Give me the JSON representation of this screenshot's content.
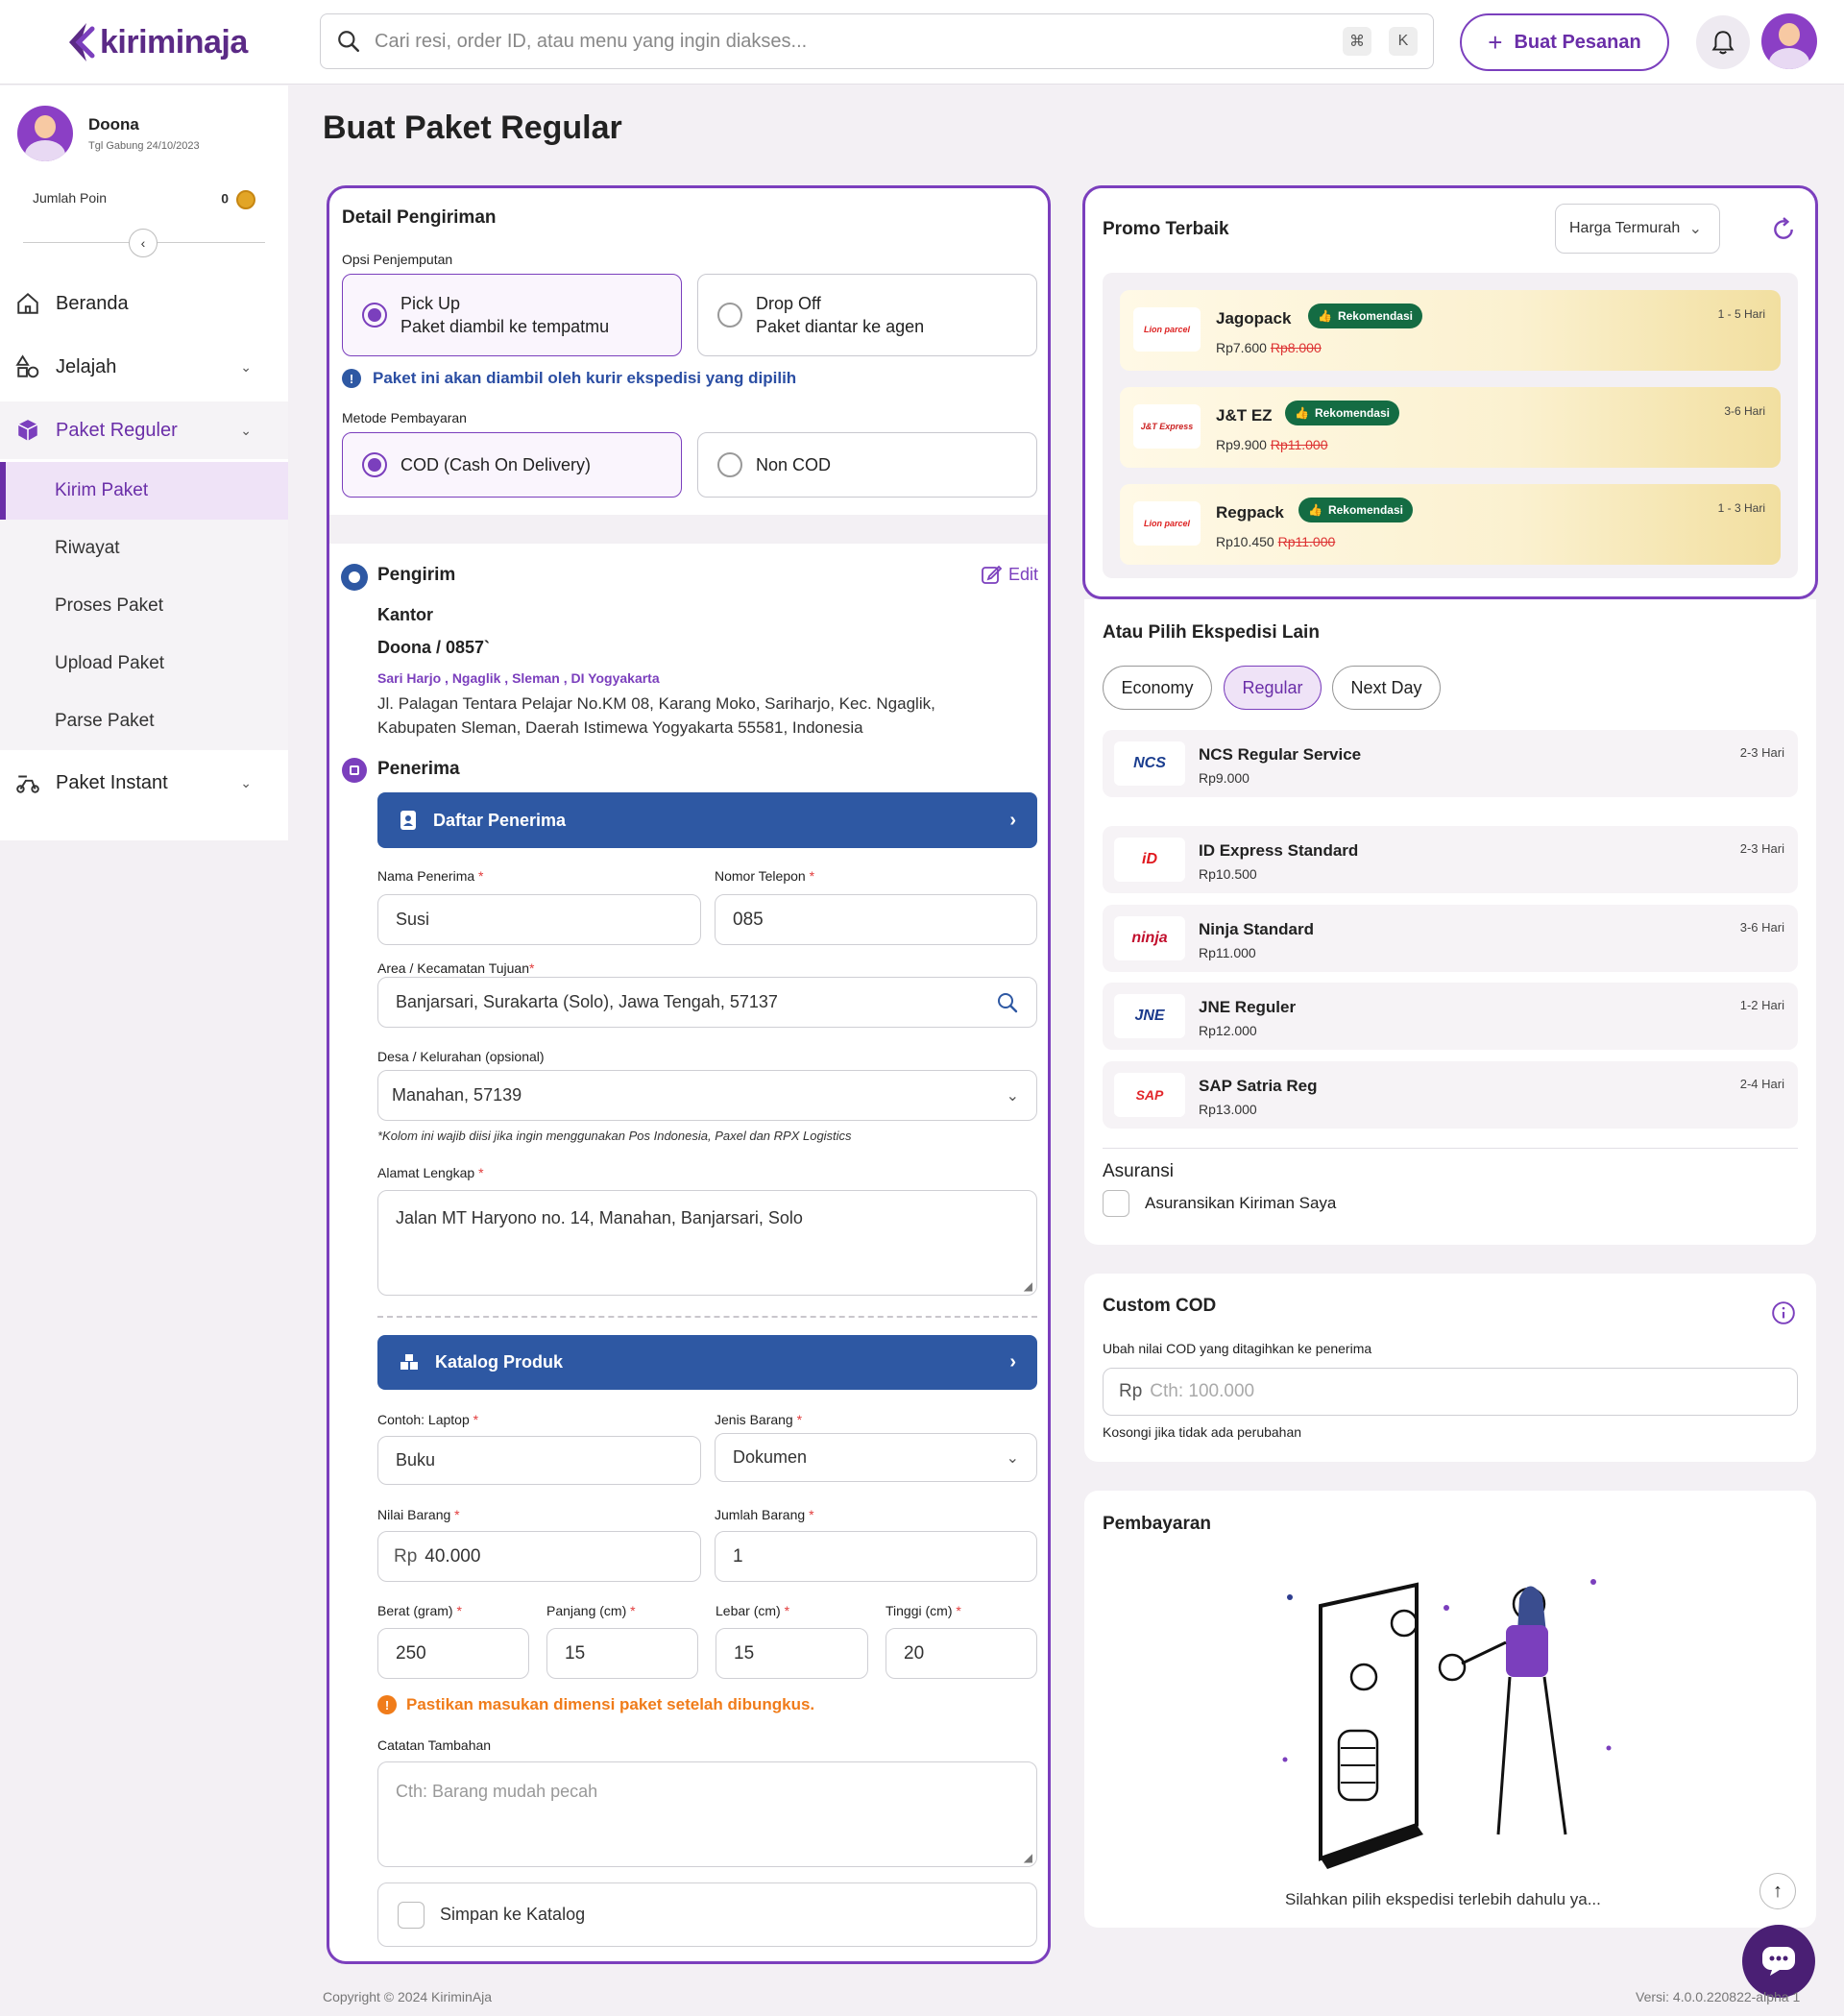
{
  "brand": {
    "name": "kiriminaja",
    "accent": "#7b3fbd",
    "blue": "#2e58a3"
  },
  "topbar": {
    "search_placeholder": "Cari resi, order ID, atau menu yang ingin diakses...",
    "kbd_cmd": "⌘",
    "kbd_k": "K",
    "create_order": "Buat Pesanan"
  },
  "sidebar": {
    "user_name": "Doona",
    "join_date": "Tgl Gabung 24/10/2023",
    "points_label": "Jumlah Poin",
    "points_value": "0",
    "items": [
      {
        "label": "Beranda"
      },
      {
        "label": "Jelajah"
      },
      {
        "label": "Paket Reguler"
      },
      {
        "label": "Paket Instant"
      }
    ],
    "sub_items": [
      {
        "label": "Kirim Paket"
      },
      {
        "label": "Riwayat"
      },
      {
        "label": "Proses Paket"
      },
      {
        "label": "Upload Paket"
      },
      {
        "label": "Parse Paket"
      }
    ]
  },
  "page_title": "Buat Paket Regular",
  "detail": {
    "title": "Detail Pengiriman",
    "pickup_label": "Opsi Penjemputan",
    "pickup_options": [
      {
        "title": "Pick Up",
        "desc": "Paket diambil ke tempatmu"
      },
      {
        "title": "Drop Off",
        "desc": "Paket diantar ke agen"
      }
    ],
    "pickup_info": "Paket ini akan diambil oleh kurir ekspedisi yang dipilih",
    "payment_label": "Metode Pembayaran",
    "payment_options": [
      {
        "title": "COD (Cash On Delivery)"
      },
      {
        "title": "Non COD"
      }
    ]
  },
  "sender": {
    "title": "Pengirim",
    "edit": "Edit",
    "place": "Kantor",
    "name_phone": "Doona / 0857`",
    "area": [
      "Sari Harjo",
      "Ngaglik",
      "Sleman",
      "DI Yogyakarta"
    ],
    "address": "Jl. Palagan Tentara Pelajar No.KM 08, Karang Moko, Sariharjo, Kec. Ngaglik, Kabupaten Sleman, Daerah Istimewa Yogyakarta 55581, Indonesia"
  },
  "receiver": {
    "title": "Penerima",
    "list_button": "Daftar Penerima",
    "name_label": "Nama Penerima",
    "name_value": "Susi",
    "phone_label": "Nomor Telepon",
    "phone_value": "085",
    "area_label": "Area / Kecamatan Tujuan",
    "area_value": "Banjarsari, Surakarta (Solo), Jawa Tengah, 57137",
    "village_label": "Desa / Kelurahan (opsional)",
    "village_value": "Manahan, 57139",
    "village_note": "*Kolom ini wajib diisi jika ingin menggunakan Pos Indonesia, Paxel dan RPX Logistics",
    "address_label": "Alamat Lengkap",
    "address_value": "Jalan MT Haryono no. 14, Manahan, Banjarsari, Solo"
  },
  "product": {
    "catalog_button": "Katalog Produk",
    "name_label": "Contoh: Laptop",
    "name_value": "Buku",
    "type_label": "Jenis Barang",
    "type_value": "Dokumen",
    "value_label": "Nilai Barang",
    "currency": "Rp",
    "value_value": "40.000",
    "qty_label": "Jumlah Barang",
    "qty_value": "1",
    "weight_label": "Berat (gram)",
    "weight_value": "250",
    "length_label": "Panjang (cm)",
    "length_value": "15",
    "width_label": "Lebar (cm)",
    "width_value": "15",
    "height_label": "Tinggi (cm)",
    "height_value": "20",
    "dimension_warning": "Pastikan masukan dimensi paket setelah dibungkus.",
    "note_label": "Catatan Tambahan",
    "note_placeholder": "Cth: Barang mudah pecah",
    "save_catalog": "Simpan ke Katalog"
  },
  "promo": {
    "title": "Promo Terbaik",
    "sort_value": "Harga Termurah",
    "badge": "Rekomendasi",
    "items": [
      {
        "logo": "Lion parcel",
        "name": "Jagopack",
        "price": "Rp7.600",
        "old_price": "Rp8.000",
        "days": "1 - 5 Hari"
      },
      {
        "logo": "J&T Express",
        "name": "J&T EZ",
        "price": "Rp9.900",
        "old_price": "Rp11.000",
        "days": "3-6 Hari"
      },
      {
        "logo": "Lion parcel",
        "name": "Regpack",
        "price": "Rp10.450",
        "old_price": "Rp11.000",
        "days": "1 - 3 Hari"
      }
    ]
  },
  "other": {
    "title": "Atau Pilih Ekspedisi Lain",
    "tabs": [
      {
        "label": "Economy"
      },
      {
        "label": "Regular"
      },
      {
        "label": "Next Day"
      }
    ],
    "items": [
      {
        "logo": "NCS",
        "name": "NCS Regular Service",
        "price": "Rp9.000",
        "days": "2-3 Hari"
      },
      {
        "logo": "iD",
        "name": "ID Express Standard",
        "price": "Rp10.500",
        "days": "2-3 Hari"
      },
      {
        "logo": "ninja",
        "name": "Ninja Standard",
        "price": "Rp11.000",
        "days": "3-6 Hari"
      },
      {
        "logo": "JNE",
        "name": "JNE Reguler",
        "price": "Rp12.000",
        "days": "1-2 Hari"
      },
      {
        "logo": "SAP",
        "name": "SAP Satria Reg",
        "price": "Rp13.000",
        "days": "2-4 Hari"
      }
    ],
    "insurance_title": "Asuransi",
    "insurance_label": "Asuransikan Kiriman Saya"
  },
  "cod": {
    "title": "Custom COD",
    "desc": "Ubah nilai COD yang ditagihkan ke penerima",
    "currency": "Rp",
    "placeholder": "Cth: 100.000",
    "hint": "Kosongi jika tidak ada perubahan"
  },
  "payment": {
    "title": "Pembayaran",
    "empty_text": "Silahkan pilih ekspedisi terlebih dahulu ya..."
  },
  "footer": {
    "copyright": "Copyright © 2024 KiriminAja",
    "version": "Versi: 4.0.0.220822-alpha 1"
  }
}
